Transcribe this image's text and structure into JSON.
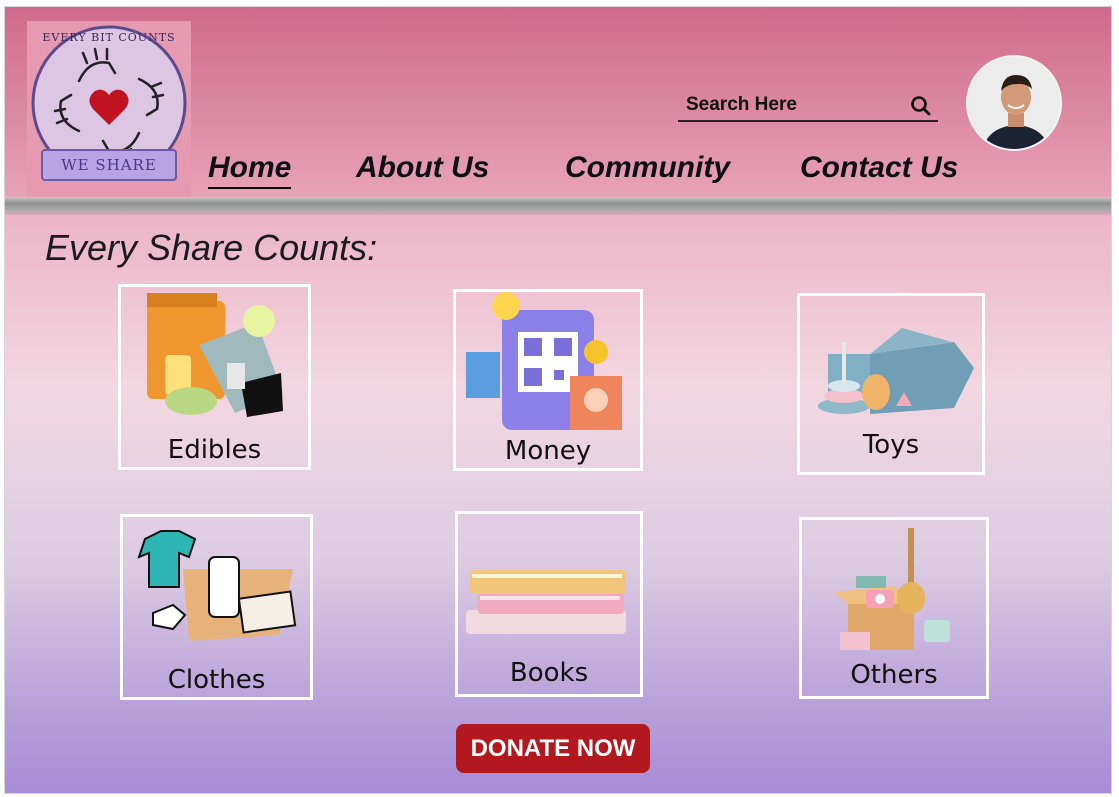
{
  "logo": {
    "top_text": "EVERY BIT COUNTS",
    "ribbon_text": "WE SHARE"
  },
  "nav": {
    "items": [
      {
        "label": "Home",
        "active": true
      },
      {
        "label": "About Us",
        "active": false
      },
      {
        "label": "Community",
        "active": false
      },
      {
        "label": "Contact Us",
        "active": false
      }
    ]
  },
  "search": {
    "placeholder": "Search Here",
    "icon": "search-icon"
  },
  "avatar": {
    "icon": "user-profile-photo"
  },
  "main": {
    "heading": "Every Share Counts:",
    "categories": [
      {
        "label": "Edibles",
        "icon": "food-groceries-icon"
      },
      {
        "label": "Money",
        "icon": "qr-payment-icon"
      },
      {
        "label": "Toys",
        "icon": "toy-box-icon"
      },
      {
        "label": "Clothes",
        "icon": "clothes-donation-icon"
      },
      {
        "label": "Books",
        "icon": "books-stack-icon"
      },
      {
        "label": "Others",
        "icon": "misc-items-box-icon"
      }
    ],
    "donate_button": "DONATE NOW"
  },
  "colors": {
    "header_top": "#d06a8c",
    "main_bottom": "#a88bd6",
    "donate_button": "#b3181f",
    "card_border": "#ffffff"
  }
}
